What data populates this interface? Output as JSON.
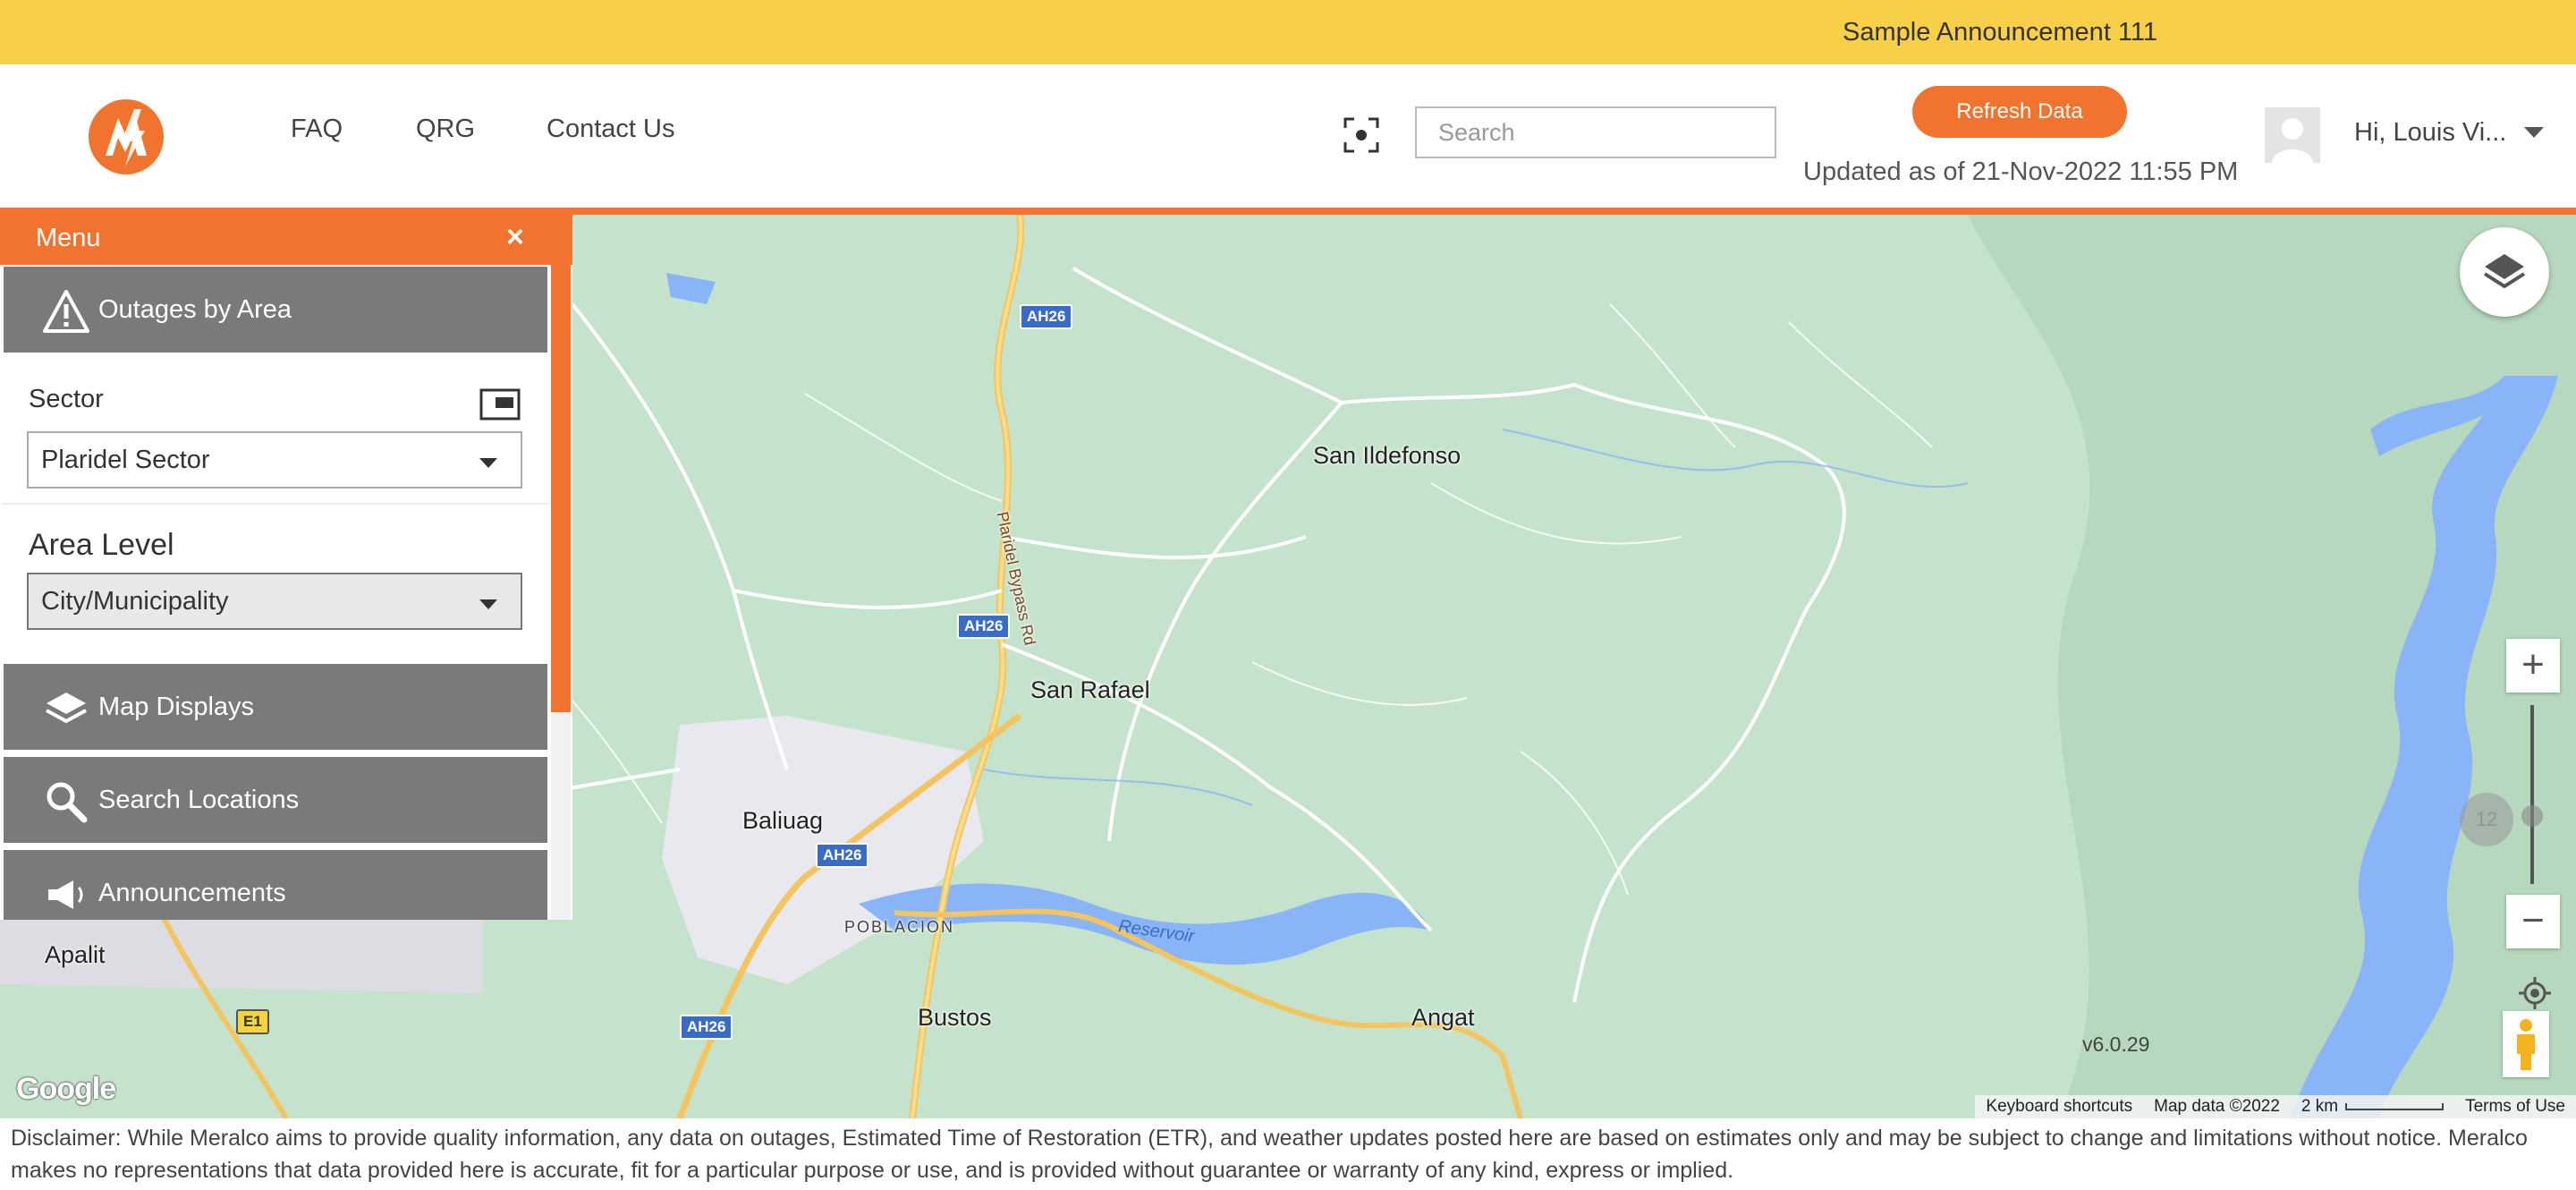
{
  "announcement": "Sample Announcement 111",
  "header": {
    "nav": [
      "FAQ",
      "QRG",
      "Contact Us"
    ],
    "search_placeholder": "Search",
    "refresh_label": "Refresh Data",
    "updated_text": "Updated as of 21-Nov-2022 11:55 PM",
    "greeting": "Hi, Louis Vi..."
  },
  "menu": {
    "title": "Menu",
    "close": "×",
    "outages_label": "Outages by Area",
    "sector_label": "Sector",
    "sector_value": "Plaridel Sector",
    "area_level_label": "Area Level",
    "area_level_value": "City/Municipality",
    "map_displays_label": "Map Displays",
    "search_locations_label": "Search Locations",
    "announcements_label": "Announcements"
  },
  "map": {
    "places": [
      "San Ildefonso",
      "San Rafael",
      "Baliuag",
      "POBLACION",
      "Bustos",
      "Angat",
      "Apalit"
    ],
    "road_labels": [
      "AH26",
      "AH26",
      "AH26",
      "AH26",
      "E1",
      "Plaridel Bypass Rd"
    ],
    "water_label": "Reservoir",
    "zoom_level": "12",
    "zoom_in": "+",
    "zoom_out": "−",
    "version": "v6.0.29",
    "google_logo": "Google",
    "attribution": {
      "shortcuts": "Keyboard shortcuts",
      "map_data": "Map data ©2022",
      "scale": "2 km",
      "terms": "Terms of Use"
    }
  },
  "disclaimer": "Disclaimer: While Meralco aims to provide quality information, any data on outages, Estimated Time of Restoration (ETR), and weather updates posted here are based on estimates only and may be subject to change and limitations without notice. Meralco makes no representations that data provided here is accurate, fit for a particular purpose or use, and is provided without guarantee or warranty of any kind, express or implied.",
  "colors": {
    "brand_orange": "#f07430",
    "announcement_bg": "#f8cf48",
    "menu_grey": "#7a7a7a",
    "map_green": "#c5e3cc",
    "water_blue": "#8ab4f8"
  }
}
